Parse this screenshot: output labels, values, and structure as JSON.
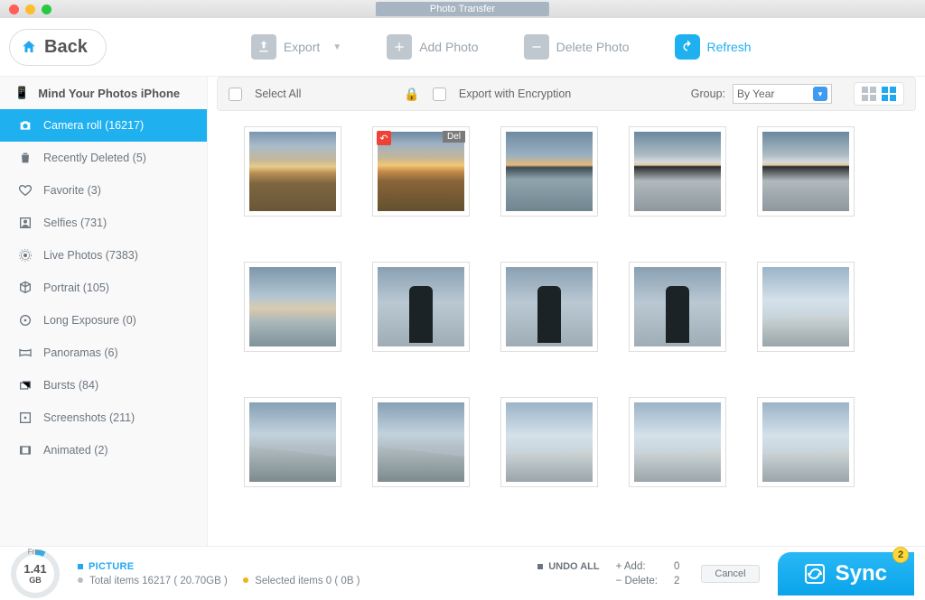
{
  "window": {
    "title": "Photo Transfer"
  },
  "toolbar": {
    "back": "Back",
    "export": "Export",
    "add_photo": "Add Photo",
    "delete_photo": "Delete Photo",
    "refresh": "Refresh"
  },
  "subtoolbar": {
    "select_all": "Select All",
    "export_encrypt": "Export with Encryption",
    "group_label": "Group:",
    "group_value": "By Year"
  },
  "device": {
    "name": "Mind Your Photos iPhone"
  },
  "sidebar": {
    "items": [
      {
        "label": "Camera roll (16217)",
        "icon": "camera"
      },
      {
        "label": "Recently Deleted (5)",
        "icon": "trash"
      },
      {
        "label": "Favorite (3)",
        "icon": "heart"
      },
      {
        "label": "Selfies (731)",
        "icon": "person"
      },
      {
        "label": "Live Photos (7383)",
        "icon": "live"
      },
      {
        "label": "Portrait (105)",
        "icon": "cube"
      },
      {
        "label": "Long Exposure (0)",
        "icon": "exposure"
      },
      {
        "label": "Panoramas (6)",
        "icon": "pano"
      },
      {
        "label": "Bursts (84)",
        "icon": "burst"
      },
      {
        "label": "Screenshots (211)",
        "icon": "screenshot"
      },
      {
        "label": "Animated (2)",
        "icon": "animated"
      }
    ]
  },
  "thumbs": [
    {
      "scene": "sky-gold",
      "del": false
    },
    {
      "scene": "sky-gold2",
      "del": true
    },
    {
      "scene": "sky-water",
      "del": false
    },
    {
      "scene": "silhouette",
      "del": false
    },
    {
      "scene": "silhouette",
      "del": false
    },
    {
      "scene": "cloudy-sunset",
      "del": false
    },
    {
      "scene": "statue",
      "del": false
    },
    {
      "scene": "statue",
      "del": false
    },
    {
      "scene": "statue",
      "del": false
    },
    {
      "scene": "prom-bright",
      "del": false
    },
    {
      "scene": "prom",
      "del": false
    },
    {
      "scene": "prom",
      "del": false
    },
    {
      "scene": "prom-bright",
      "del": false
    },
    {
      "scene": "prom-bright",
      "del": false
    },
    {
      "scene": "prom-bright",
      "del": false
    }
  ],
  "del_badge": "Del",
  "footer": {
    "free_label": "Free",
    "free_value": "1.41",
    "free_unit": "GB",
    "picture": "PICTURE",
    "totals": "Total items 16217 ( 20.70GB )",
    "selected": "Selected items 0 ( 0B )",
    "undo_all": "UNDO ALL",
    "add_label": "+ Add:",
    "add_value": "0",
    "delete_label": "− Delete:",
    "delete_value": "2",
    "cancel": "Cancel",
    "sync": "Sync",
    "sync_badge": "2"
  }
}
